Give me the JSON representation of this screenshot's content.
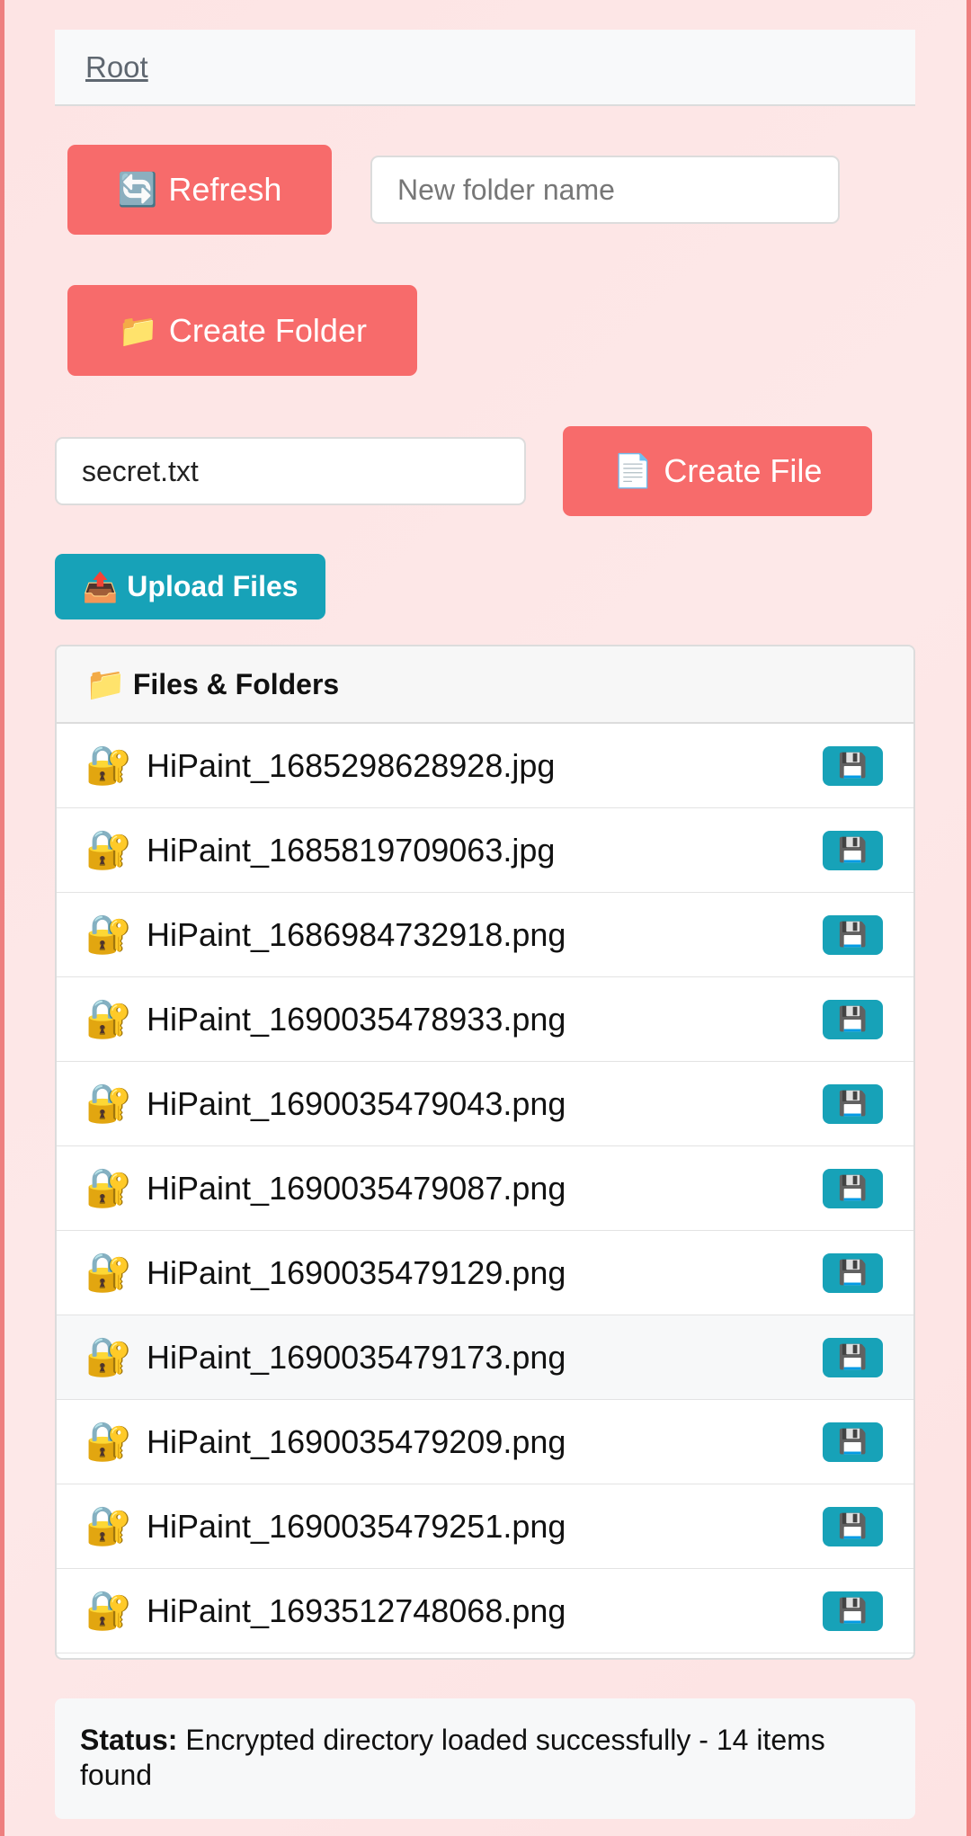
{
  "breadcrumb": {
    "root_label": "Root"
  },
  "toolbar": {
    "refresh_icon": "🔄",
    "refresh_label": "Refresh",
    "folder_input_placeholder": "New folder name",
    "create_folder_icon": "📁",
    "create_folder_label": "Create Folder",
    "file_input_value": "secret.txt",
    "create_file_icon": "📄",
    "create_file_label": "Create File",
    "upload_icon": "📤",
    "upload_label": "Upload Files"
  },
  "panel": {
    "header_icon": "📁",
    "header_label": "Files & Folders",
    "row_icon": "🔐",
    "save_icon": "💾",
    "files": [
      "HiPaint_1685298628928.jpg",
      "HiPaint_1685819709063.jpg",
      "HiPaint_1686984732918.png",
      "HiPaint_1690035478933.png",
      "HiPaint_1690035479043.png",
      "HiPaint_1690035479087.png",
      "HiPaint_1690035479129.png",
      "HiPaint_1690035479173.png",
      "HiPaint_1690035479209.png",
      "HiPaint_1690035479251.png",
      "HiPaint_1693512748068.png"
    ]
  },
  "status": {
    "label": "Status:",
    "message": " Encrypted directory loaded successfully - 14 items found"
  },
  "colors": {
    "accent_coral": "#f76b6b",
    "accent_teal": "#17a2b8",
    "background": "#fde4e4"
  }
}
